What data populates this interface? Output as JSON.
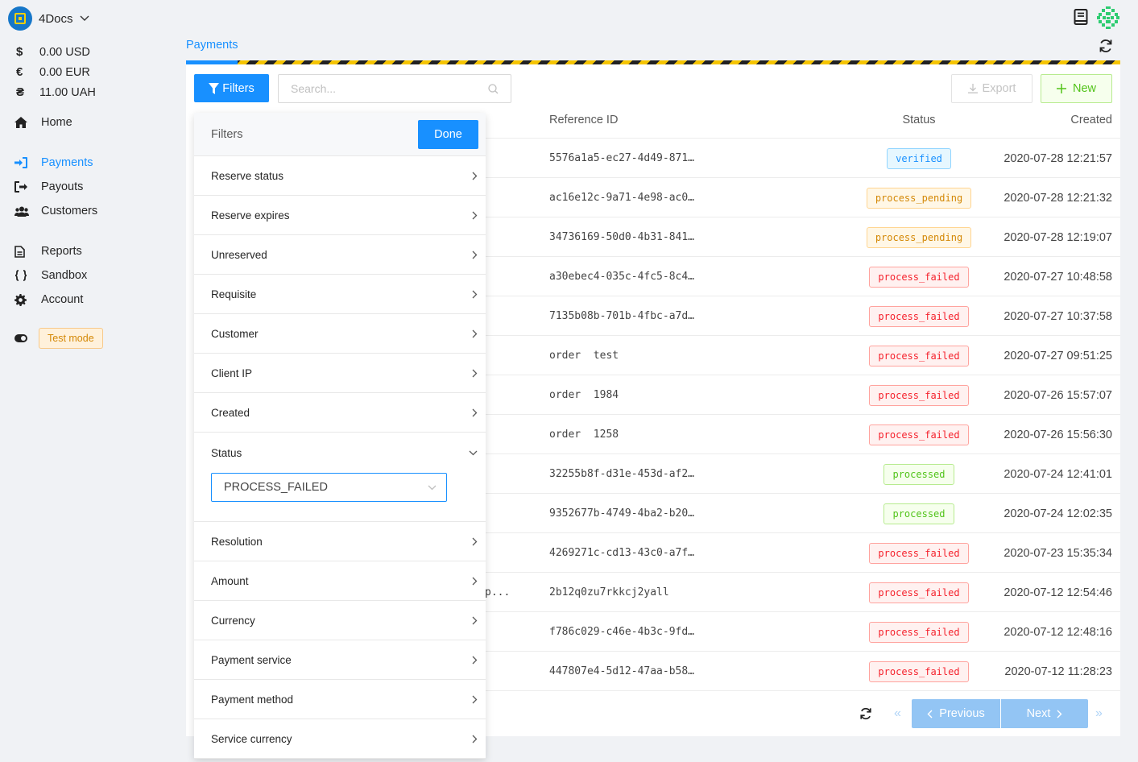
{
  "app": {
    "name": "4Docs"
  },
  "balances": [
    {
      "symbol": "$",
      "amount": "0.00 USD"
    },
    {
      "symbol": "€",
      "amount": "0.00 EUR"
    },
    {
      "symbol": "₴",
      "amount": "11.00 UAH"
    }
  ],
  "nav": {
    "home": "Home",
    "payments": "Payments",
    "payouts": "Payouts",
    "customers": "Customers",
    "reports": "Reports",
    "sandbox": "Sandbox",
    "account": "Account"
  },
  "test_mode": "Test mode",
  "breadcrumb": "Payments",
  "toolbar": {
    "filters_label": "Filters",
    "search_placeholder": "Search...",
    "export_label": "Export",
    "new_label": "New"
  },
  "table": {
    "headers": {
      "reference": "Reference ID",
      "status": "Status",
      "created": "Created"
    },
    "partial_text": "p...",
    "rows": [
      {
        "ref": "5576a1a5-ec27-4d49-871…",
        "status": "verified",
        "created": "2020-07-28 12:21:57"
      },
      {
        "ref": "ac16e12c-9a71-4e98-ac0…",
        "status": "process_pending",
        "created": "2020-07-28 12:21:32"
      },
      {
        "ref": "34736169-50d0-4b31-841…",
        "status": "process_pending",
        "created": "2020-07-28 12:19:07"
      },
      {
        "ref": "a30ebec4-035c-4fc5-8c4…",
        "status": "process_failed",
        "created": "2020-07-27 10:48:58"
      },
      {
        "ref": "7135b08b-701b-4fbc-a7d…",
        "status": "process_failed",
        "created": "2020-07-27 10:37:58"
      },
      {
        "ref": "order  test",
        "status": "process_failed",
        "created": "2020-07-27 09:51:25"
      },
      {
        "ref": "order  1984",
        "status": "process_failed",
        "created": "2020-07-26 15:57:07"
      },
      {
        "ref": "order  1258",
        "status": "process_failed",
        "created": "2020-07-26 15:56:30"
      },
      {
        "ref": "32255b8f-d31e-453d-af2…",
        "status": "processed",
        "created": "2020-07-24 12:41:01"
      },
      {
        "ref": "9352677b-4749-4ba2-b20…",
        "status": "processed",
        "created": "2020-07-24 12:02:35"
      },
      {
        "ref": "4269271c-cd13-43c0-a7f…",
        "status": "process_failed",
        "created": "2020-07-23 15:35:34"
      },
      {
        "ref": "2b12q0zu7rkkcj2yall",
        "status": "process_failed",
        "created": "2020-07-12 12:54:46"
      },
      {
        "ref": "f786c029-c46e-4b3c-9fd…",
        "status": "process_failed",
        "created": "2020-07-12 12:48:16"
      },
      {
        "ref": "447807e4-5d12-47aa-b58…",
        "status": "process_failed",
        "created": "2020-07-12 11:28:23"
      }
    ]
  },
  "pagination": {
    "previous": "Previous",
    "next": "Next"
  },
  "filters": {
    "title": "Filters",
    "done": "Done",
    "items_before": [
      "Reserve status",
      "Reserve expires",
      "Unreserved",
      "Requisite",
      "Customer",
      "Client IP",
      "Created"
    ],
    "status": {
      "label": "Status",
      "selected": "PROCESS_FAILED"
    },
    "items_after": [
      "Resolution",
      "Amount",
      "Currency",
      "Payment service",
      "Payment method",
      "Service currency"
    ]
  },
  "colors": {
    "accent": "#1890ff",
    "success": "#52c41a",
    "warning": "#d48806",
    "error": "#f5222d"
  }
}
